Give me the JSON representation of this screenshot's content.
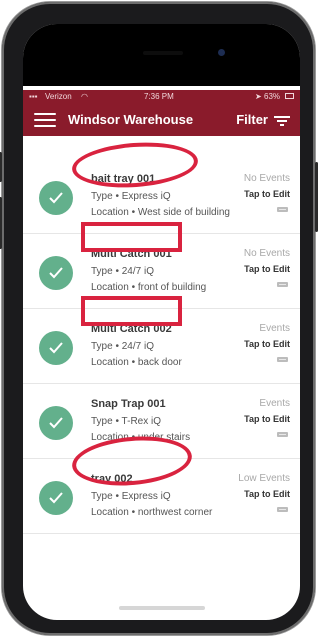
{
  "status_bar": {
    "carrier": "Verizon",
    "time": "7:36 PM",
    "battery": "63%"
  },
  "header": {
    "title": "Windsor Warehouse",
    "filter_label": "Filter"
  },
  "devices": [
    {
      "name": "bait tray 001",
      "type": "Type • Express iQ",
      "location": "Location • West side of building",
      "events": "No Events",
      "action": "Tap to Edit"
    },
    {
      "name": "Multi Catch 001",
      "type": "Type • 24/7 iQ",
      "location": "Location • front of building",
      "events": "No Events",
      "action": "Tap to Edit"
    },
    {
      "name": "Multi Catch 002",
      "type": "Type • 24/7 iQ",
      "location": "Location • back door",
      "events": "Events",
      "action": "Tap to Edit"
    },
    {
      "name": "Snap Trap 001",
      "type": "Type • T-Rex iQ",
      "location": "Location • under stairs",
      "events": "Events",
      "action": "Tap to Edit"
    },
    {
      "name": "tray 002",
      "type": "Type • Express iQ",
      "location": "Location • northwest corner",
      "events": "Low Events",
      "action": "Tap to Edit"
    }
  ],
  "colors": {
    "header_bg": "#8a1b2b",
    "check_green": "#63b08c",
    "annotation_red": "#d9233f"
  }
}
